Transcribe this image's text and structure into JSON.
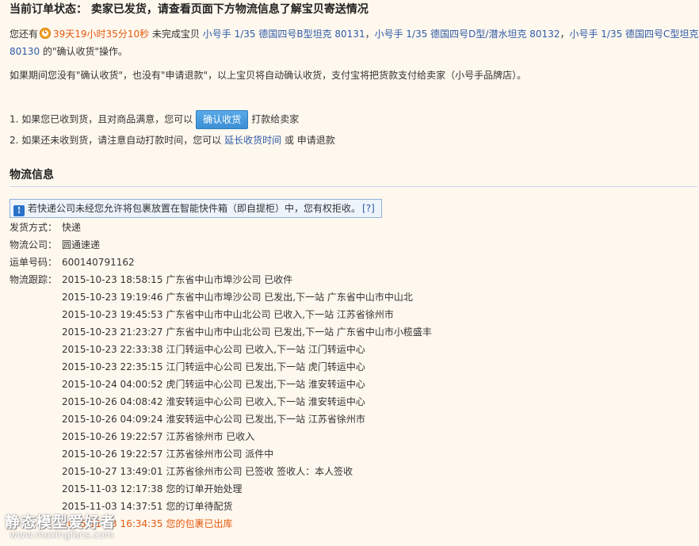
{
  "status": {
    "title": "当前订单状态： 卖家已发货，请查看页面下方物流信息了解宝贝寄送情况"
  },
  "reminder": {
    "prefix": "您还有",
    "countdown": "39天19小时35分10秒",
    "middle": "未完成宝贝",
    "item_links": [
      "小号手 1/35 德国四号B型坦克 80131",
      "小号手 1/35 德国四号D型/潜水坦克 80132",
      "小号手 1/35 德国四号C型坦克 80130"
    ],
    "separator": "，",
    "suffix": "的\"确认收货\"操作。",
    "auto_confirm_note": "如果期间您没有\"确认收货\"，也没有\"申请退款\"，以上宝贝将自动确认收货，支付宝将把货款支付给卖家（小号手品牌店）。"
  },
  "instructions": {
    "step1_prefix": "1. 如果您已收到货，且对商品满意，您可以",
    "confirm_button": "确认收货",
    "step1_suffix": "打款给卖家",
    "step2_prefix": "2. 如果还未收到货，请注意自动打款时间，您可以",
    "extend_link": "延长收货时间",
    "step2_suffix": "或 申请退款"
  },
  "logistics": {
    "section_title": "物流信息",
    "notice": "若快递公司未经您允许将包裹放置在智能快件箱（即自提柜）中，您有权拒收。",
    "notice_help": "[?]",
    "method_label": "发货方式：",
    "method_value": "快递",
    "company_label": "物流公司：",
    "company_value": "圆通速递",
    "waybill_label": "运单号码：",
    "waybill_value": "600140791162",
    "tracking_label": "物流跟踪：",
    "tracking": [
      {
        "time": "2015-10-23 18:58:15",
        "event": "广东省中山市埠沙公司 已收件"
      },
      {
        "time": "2015-10-23 19:19:46",
        "event": "广东省中山市埠沙公司 已发出,下一站 广东省中山市中山北"
      },
      {
        "time": "2015-10-23 19:45:53",
        "event": "广东省中山市中山北公司 已收入,下一站 江苏省徐州市"
      },
      {
        "time": "2015-10-23 21:23:27",
        "event": "广东省中山市中山北公司 已发出,下一站 广东省中山市小榄盛丰"
      },
      {
        "time": "2015-10-23 22:33:38",
        "event": "江门转运中心公司 已收入,下一站 江门转运中心"
      },
      {
        "time": "2015-10-23 22:35:15",
        "event": "江门转运中心公司 已发出,下一站 虎门转运中心"
      },
      {
        "time": "2015-10-24 04:00:52",
        "event": "虎门转运中心公司 已发出,下一站 淮安转运中心"
      },
      {
        "time": "2015-10-26 04:08:42",
        "event": "淮安转运中心公司 已收入,下一站 淮安转运中心"
      },
      {
        "time": "2015-10-26 04:09:24",
        "event": "淮安转运中心公司 已发出,下一站 江苏省徐州市"
      },
      {
        "time": "2015-10-26 19:22:57",
        "event": "江苏省徐州市 已收入"
      },
      {
        "time": "2015-10-26 19:22:57",
        "event": "江苏省徐州市公司 派件中"
      },
      {
        "time": "2015-10-27 13:49:01",
        "event": "江苏省徐州市公司 已签收 签收人：本人签收"
      },
      {
        "time": "2015-11-03 12:17:38",
        "event": "您的订单开始处理"
      },
      {
        "time": "2015-11-03 14:37:51",
        "event": "您的订单待配货"
      },
      {
        "time": "2015-11-03 16:34:35",
        "event": "您的包裹已出库"
      }
    ]
  },
  "watermark": {
    "site_name": "静态模型爱好者",
    "url": "www.moxingfans.com"
  },
  "colors": {
    "background": "#fff8ee",
    "countdown": "#e4590f",
    "link": "#2f5ba8",
    "button": "#3c8fd4",
    "notice_border": "#8fb1dc",
    "latest_event": "#e4590f"
  }
}
